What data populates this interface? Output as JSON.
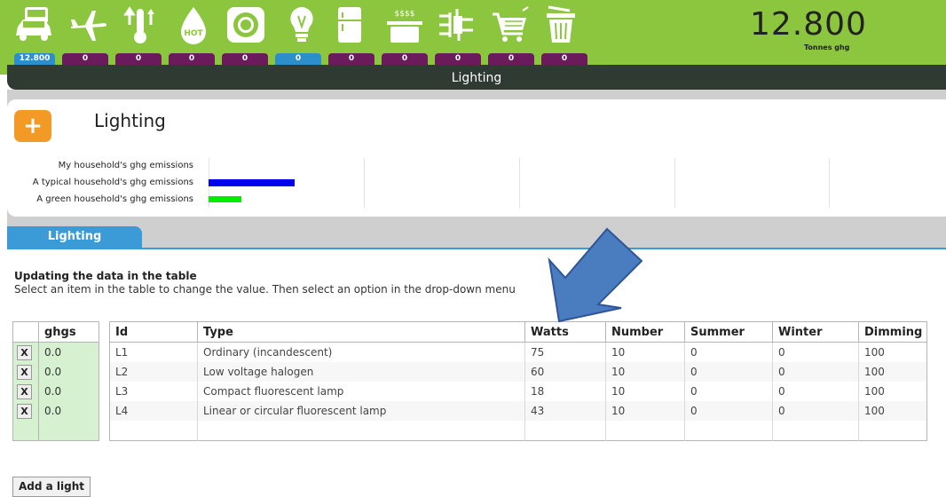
{
  "header": {
    "total_value": "12.800",
    "total_unit": "Tonnes ghg",
    "current_section": "Lighting",
    "badges": [
      "12.800",
      "0",
      "0",
      "0",
      "0",
      "0",
      "0",
      "0",
      "0",
      "0",
      "0"
    ],
    "categories": [
      "car-icon",
      "plane-icon",
      "thermometer-icon",
      "hot-water-icon",
      "washing-machine-icon",
      "light-bulb-icon",
      "fridge-icon",
      "cooking-pot-icon",
      "plug-icon",
      "shopping-cart-icon",
      "trash-bin-icon"
    ],
    "hot_label": "HOT",
    "steam_label": "$$$$"
  },
  "section": {
    "title": "Lighting",
    "tab_label": "Lighting"
  },
  "comparison": {
    "labels": [
      "My household's ghg emissions",
      "A typical household's ghg emissions",
      "A green household's ghg emissions"
    ],
    "bar_colors": [
      "#0000ee",
      "#00ee00"
    ]
  },
  "help": {
    "title": "Updating the data in the table",
    "text": "Select an item in the table to change the value. Then select an option in the drop-down menu"
  },
  "ghgs_table": {
    "header": "ghgs",
    "delete_label": "X",
    "values": [
      "0.0",
      "0.0",
      "0.0",
      "0.0"
    ]
  },
  "lights_table": {
    "columns": [
      "Id",
      "Type",
      "Watts",
      "Number",
      "Summer",
      "Winter",
      "Dimming"
    ],
    "rows": [
      [
        "L1",
        "Ordinary (incandescent)",
        "75",
        "10",
        "0",
        "0",
        "100"
      ],
      [
        "L2",
        "Low voltage halogen",
        "60",
        "10",
        "0",
        "0",
        "100"
      ],
      [
        "L3",
        "Compact fluorescent lamp",
        "18",
        "10",
        "0",
        "0",
        "100"
      ],
      [
        "L4",
        "Linear or circular fluorescent lamp",
        "43",
        "10",
        "0",
        "0",
        "100"
      ]
    ]
  },
  "add_button_label": "Add a light",
  "colors": {
    "header_green": "#8cc63f",
    "badge_purple": "#6b1a5b",
    "active_blue": "#2d8ecc",
    "tab_blue": "#3a9bd6",
    "ghgs_green": "#d5f1cf",
    "accent_orange": "#f39a26",
    "arrow_blue": "#4a7cc0"
  }
}
